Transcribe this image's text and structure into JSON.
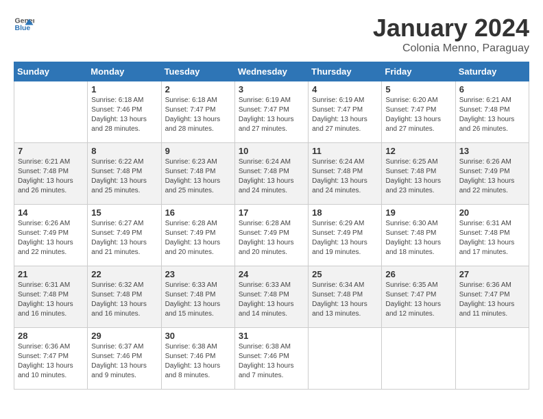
{
  "header": {
    "logo_general": "General",
    "logo_blue": "Blue",
    "title": "January 2024",
    "subtitle": "Colonia Menno, Paraguay"
  },
  "days_of_week": [
    "Sunday",
    "Monday",
    "Tuesday",
    "Wednesday",
    "Thursday",
    "Friday",
    "Saturday"
  ],
  "weeks": [
    [
      {
        "num": "",
        "info": ""
      },
      {
        "num": "1",
        "info": "Sunrise: 6:18 AM\nSunset: 7:46 PM\nDaylight: 13 hours\nand 28 minutes."
      },
      {
        "num": "2",
        "info": "Sunrise: 6:18 AM\nSunset: 7:47 PM\nDaylight: 13 hours\nand 28 minutes."
      },
      {
        "num": "3",
        "info": "Sunrise: 6:19 AM\nSunset: 7:47 PM\nDaylight: 13 hours\nand 27 minutes."
      },
      {
        "num": "4",
        "info": "Sunrise: 6:19 AM\nSunset: 7:47 PM\nDaylight: 13 hours\nand 27 minutes."
      },
      {
        "num": "5",
        "info": "Sunrise: 6:20 AM\nSunset: 7:47 PM\nDaylight: 13 hours\nand 27 minutes."
      },
      {
        "num": "6",
        "info": "Sunrise: 6:21 AM\nSunset: 7:48 PM\nDaylight: 13 hours\nand 26 minutes."
      }
    ],
    [
      {
        "num": "7",
        "info": "Sunrise: 6:21 AM\nSunset: 7:48 PM\nDaylight: 13 hours\nand 26 minutes."
      },
      {
        "num": "8",
        "info": "Sunrise: 6:22 AM\nSunset: 7:48 PM\nDaylight: 13 hours\nand 25 minutes."
      },
      {
        "num": "9",
        "info": "Sunrise: 6:23 AM\nSunset: 7:48 PM\nDaylight: 13 hours\nand 25 minutes."
      },
      {
        "num": "10",
        "info": "Sunrise: 6:24 AM\nSunset: 7:48 PM\nDaylight: 13 hours\nand 24 minutes."
      },
      {
        "num": "11",
        "info": "Sunrise: 6:24 AM\nSunset: 7:48 PM\nDaylight: 13 hours\nand 24 minutes."
      },
      {
        "num": "12",
        "info": "Sunrise: 6:25 AM\nSunset: 7:48 PM\nDaylight: 13 hours\nand 23 minutes."
      },
      {
        "num": "13",
        "info": "Sunrise: 6:26 AM\nSunset: 7:49 PM\nDaylight: 13 hours\nand 22 minutes."
      }
    ],
    [
      {
        "num": "14",
        "info": "Sunrise: 6:26 AM\nSunset: 7:49 PM\nDaylight: 13 hours\nand 22 minutes."
      },
      {
        "num": "15",
        "info": "Sunrise: 6:27 AM\nSunset: 7:49 PM\nDaylight: 13 hours\nand 21 minutes."
      },
      {
        "num": "16",
        "info": "Sunrise: 6:28 AM\nSunset: 7:49 PM\nDaylight: 13 hours\nand 20 minutes."
      },
      {
        "num": "17",
        "info": "Sunrise: 6:28 AM\nSunset: 7:49 PM\nDaylight: 13 hours\nand 20 minutes."
      },
      {
        "num": "18",
        "info": "Sunrise: 6:29 AM\nSunset: 7:49 PM\nDaylight: 13 hours\nand 19 minutes."
      },
      {
        "num": "19",
        "info": "Sunrise: 6:30 AM\nSunset: 7:48 PM\nDaylight: 13 hours\nand 18 minutes."
      },
      {
        "num": "20",
        "info": "Sunrise: 6:31 AM\nSunset: 7:48 PM\nDaylight: 13 hours\nand 17 minutes."
      }
    ],
    [
      {
        "num": "21",
        "info": "Sunrise: 6:31 AM\nSunset: 7:48 PM\nDaylight: 13 hours\nand 16 minutes."
      },
      {
        "num": "22",
        "info": "Sunrise: 6:32 AM\nSunset: 7:48 PM\nDaylight: 13 hours\nand 16 minutes."
      },
      {
        "num": "23",
        "info": "Sunrise: 6:33 AM\nSunset: 7:48 PM\nDaylight: 13 hours\nand 15 minutes."
      },
      {
        "num": "24",
        "info": "Sunrise: 6:33 AM\nSunset: 7:48 PM\nDaylight: 13 hours\nand 14 minutes."
      },
      {
        "num": "25",
        "info": "Sunrise: 6:34 AM\nSunset: 7:48 PM\nDaylight: 13 hours\nand 13 minutes."
      },
      {
        "num": "26",
        "info": "Sunrise: 6:35 AM\nSunset: 7:47 PM\nDaylight: 13 hours\nand 12 minutes."
      },
      {
        "num": "27",
        "info": "Sunrise: 6:36 AM\nSunset: 7:47 PM\nDaylight: 13 hours\nand 11 minutes."
      }
    ],
    [
      {
        "num": "28",
        "info": "Sunrise: 6:36 AM\nSunset: 7:47 PM\nDaylight: 13 hours\nand 10 minutes."
      },
      {
        "num": "29",
        "info": "Sunrise: 6:37 AM\nSunset: 7:46 PM\nDaylight: 13 hours\nand 9 minutes."
      },
      {
        "num": "30",
        "info": "Sunrise: 6:38 AM\nSunset: 7:46 PM\nDaylight: 13 hours\nand 8 minutes."
      },
      {
        "num": "31",
        "info": "Sunrise: 6:38 AM\nSunset: 7:46 PM\nDaylight: 13 hours\nand 7 minutes."
      },
      {
        "num": "",
        "info": ""
      },
      {
        "num": "",
        "info": ""
      },
      {
        "num": "",
        "info": ""
      }
    ]
  ]
}
